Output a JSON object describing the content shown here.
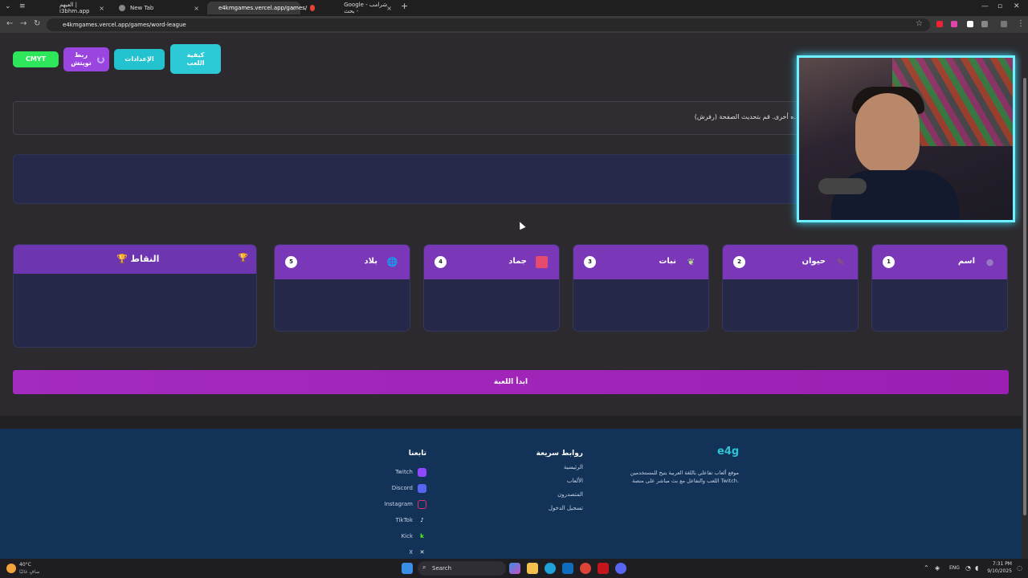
{
  "browser": {
    "tabs": [
      {
        "label": "العيهم | i3bhm.app"
      },
      {
        "label": "New Tab"
      },
      {
        "label": "e4kmgames.vercel.app/games/"
      },
      {
        "label": "Google - شرامب - بحث"
      }
    ],
    "url": "e4kmgames.vercel.app/games/word-league"
  },
  "toolbar": {
    "cmyt_label": "CMYT",
    "twitch_connect_label": "ربط تويتش",
    "settings_label": "الإعدادات",
    "howto_label": "كيفية اللعب"
  },
  "notice": {
    "text": "ه أخرى. قم بتحديث الصفحة (رفرش)."
  },
  "categories": [
    {
      "number": "1",
      "label": "اسم",
      "icon": "person-icon"
    },
    {
      "number": "2",
      "label": "حيوان",
      "icon": "paw-icon"
    },
    {
      "number": "3",
      "label": "نبات",
      "icon": "leaf-icon"
    },
    {
      "number": "4",
      "label": "جماد",
      "icon": "box-icon"
    },
    {
      "number": "5",
      "label": "بلاد",
      "icon": "globe-icon"
    }
  ],
  "points": {
    "label": "🏆 النقاط",
    "trophy": "🏆"
  },
  "start_button": "ابدأ اللعبة",
  "footer": {
    "brand": "e4g",
    "about": "موقع ألعاب تفاعلي باللغة العربية يتيح للمستخدمين اللعب والتفاعل مع بث مباشر على منصة Twitch.",
    "quick_links": {
      "title": "روابط سريعة",
      "items": [
        "الرئيسية",
        "الألعاب",
        "المتصدرون",
        "تسجيل الدخول"
      ]
    },
    "follow": {
      "title": "تابعنا",
      "items": [
        "Twitch",
        "Discord",
        "Instagram",
        "TikTok",
        "Kick",
        "X"
      ]
    }
  },
  "taskbar": {
    "weather_temp": "40°C",
    "weather_desc": "صافٍ غالبًا",
    "search_label": "Search",
    "lang": "ENG",
    "time": "7:31 PM",
    "date": "9/10/2025"
  },
  "colors": {
    "cmyt": "#2ee65a",
    "twitch": "#9b45e0",
    "accent_teal": "#22c3cf",
    "header_purple": "#7a38b8",
    "footer_bg": "#123257"
  }
}
